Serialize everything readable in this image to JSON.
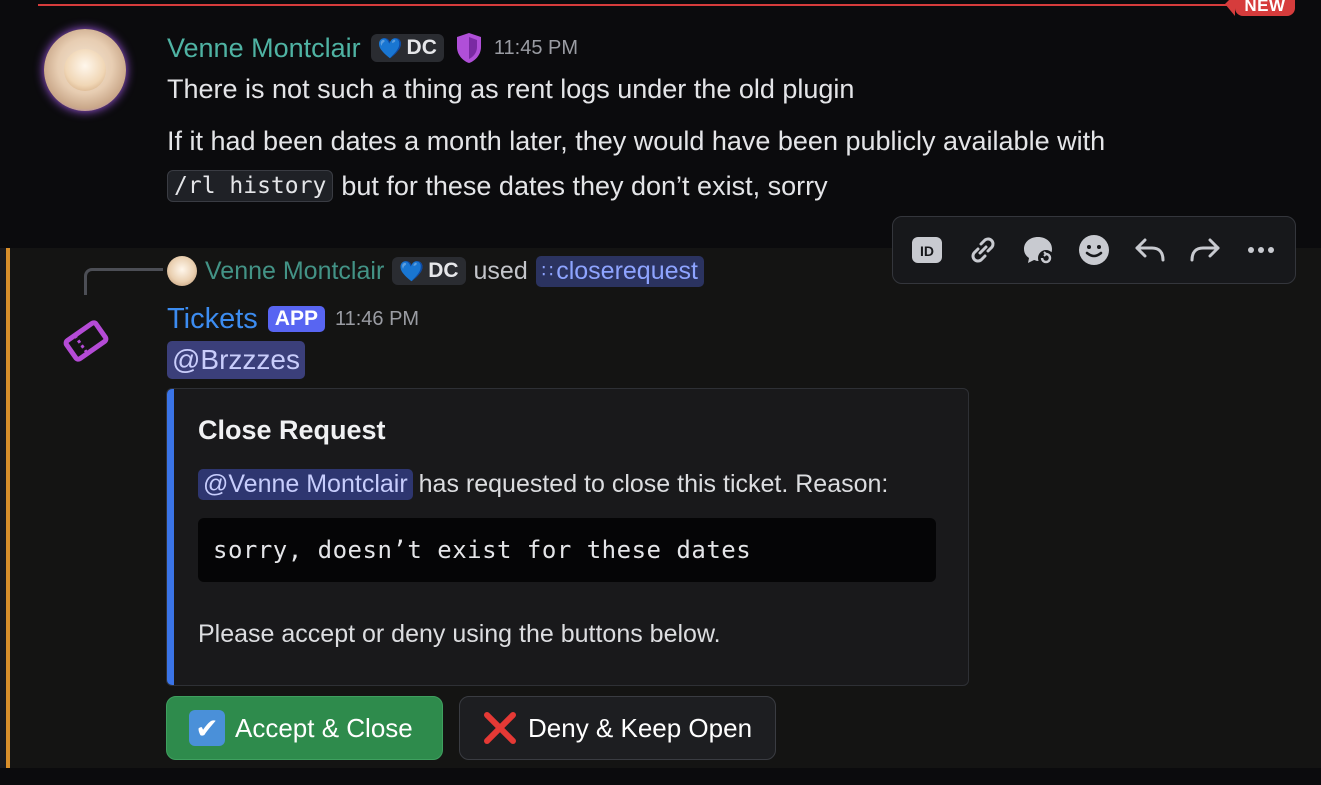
{
  "banner": {
    "new_label": "NEW"
  },
  "message1": {
    "author": "Venne Montclair",
    "tag": "DC",
    "time": "11:45 PM",
    "line1": "There is not such a thing as rent logs under the old plugin",
    "line2": "If it had been dates a month later, they would have been publicly available with",
    "code": "/rl history",
    "line3_rest": "but for these dates they don’t exist, sorry"
  },
  "reply": {
    "author": "Venne Montclair",
    "tag": "DC",
    "used": "used",
    "command": "closerequest"
  },
  "bot": {
    "name": "Tickets",
    "badge": "APP",
    "time": "11:46 PM",
    "mention": "@Brzzzes"
  },
  "embed": {
    "title": "Close Request",
    "mention": "@Venne Montclair",
    "desc_rest": "has requested to close this ticket. Reason:",
    "reason": "sorry, doesn’t exist for these dates",
    "footer": "Please accept or deny using the buttons below.",
    "accent_color": "#3a74e8"
  },
  "buttons": {
    "accept": "Accept & Close",
    "deny": "Deny & Keep Open"
  },
  "toolbar": {
    "icons": [
      "id-icon",
      "link-icon",
      "thread-reply-icon",
      "emoji-icon",
      "reply-icon",
      "forward-icon",
      "more-icon"
    ]
  },
  "colors": {
    "username": "#4fb3a3",
    "bot_name": "#3c8cf0",
    "new_line": "#d63c3c",
    "accept_green": "#2e8b4c",
    "highlight_bar": "#d98f2b"
  }
}
